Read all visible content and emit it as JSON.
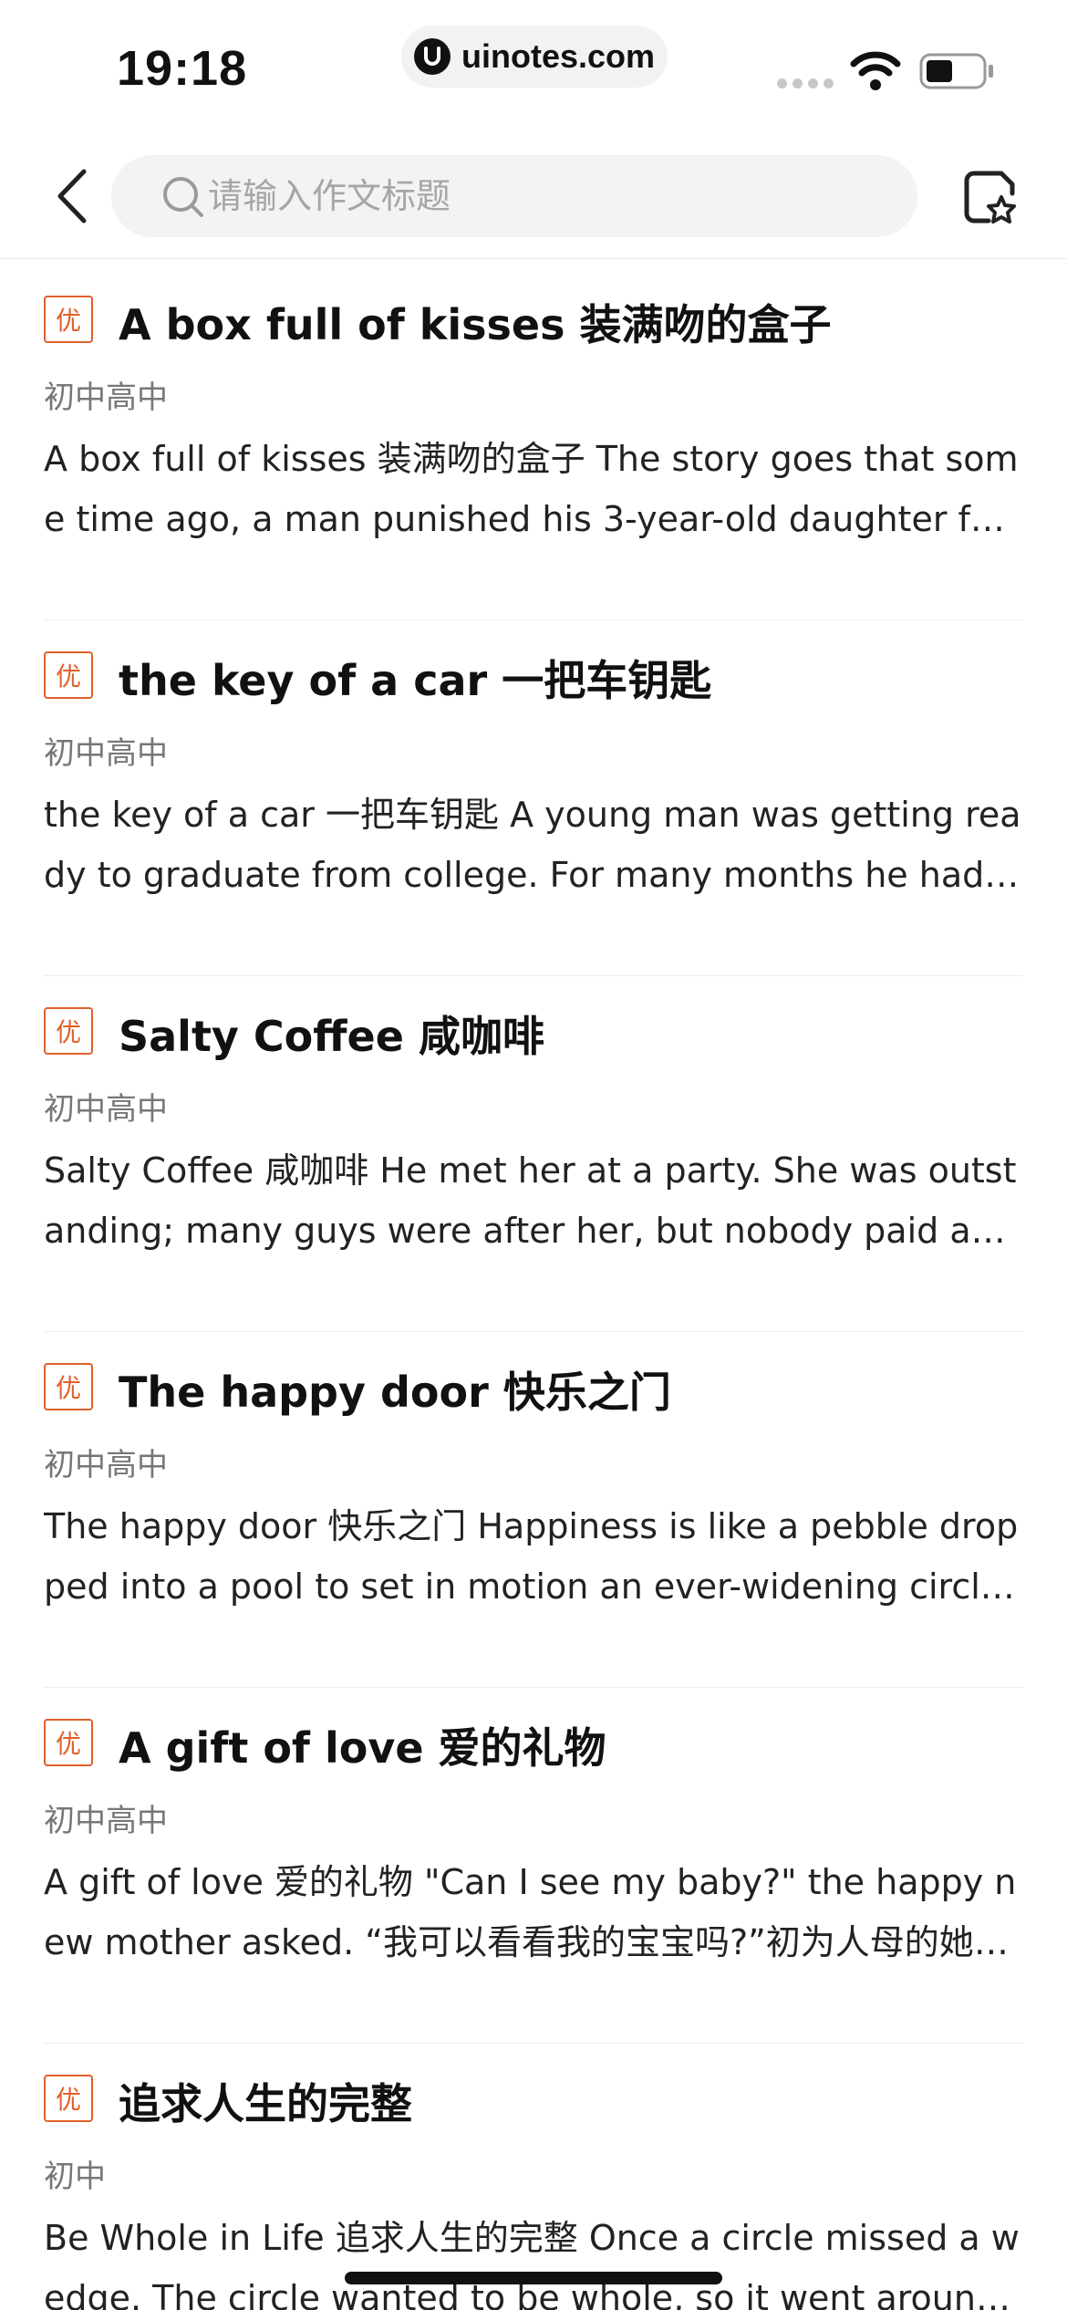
{
  "status_bar": {
    "time": "19:18",
    "url": "uinotes.com"
  },
  "nav": {
    "back_icon": "chevron-left-icon",
    "search_placeholder": "请输入作文标题",
    "favorite_icon": "favorites-icon"
  },
  "colors": {
    "accent": "#e0602a"
  },
  "essays": [
    {
      "badge": "优",
      "title": "A box full of kisses 装满吻的盒子",
      "grade": "初中高中",
      "excerpt": "A box full of kisses 装满吻的盒子 The story goes that some time ago, a man punished his 3-year-old daughter for wasting a roll of expensive gold wrapping paper."
    },
    {
      "badge": "优",
      "title": "the key of a car 一把车钥匙",
      "grade": "初中高中",
      "excerpt": "the key of a car 一把车钥匙 A young man was getting ready to graduate from college. For many months he had admired a beautiful sports car in a dealer's showroom."
    },
    {
      "badge": "优",
      "title": "Salty Coffee 咸咖啡",
      "grade": "初中高中",
      "excerpt": "Salty Coffee 咸咖啡 He met her at a party. She was outstanding; many guys were after her, but nobody paid any attention to him."
    },
    {
      "badge": "优",
      "title": "The happy door 快乐之门",
      "grade": "初中高中",
      "excerpt": "The happy door 快乐之门 Happiness is like a pebble dropped into a pool to set in motion an ever-widening circle of ripples."
    },
    {
      "badge": "优",
      "title": "A gift of love 爱的礼物",
      "grade": "初中高中",
      "excerpt": "A gift of love 爱的礼物 \"Can I see my baby?\" the happy new mother asked. “我可以看看我的宝宝吗?”初为人母的她高兴地问道。"
    },
    {
      "badge": "优",
      "title": "追求人生的完整",
      "grade": "初中",
      "excerpt": "Be Whole in Life 追求人生的完整 Once a circle missed a wedge. The circle wanted to be whole, so it went around looking for its missing piece."
    }
  ]
}
